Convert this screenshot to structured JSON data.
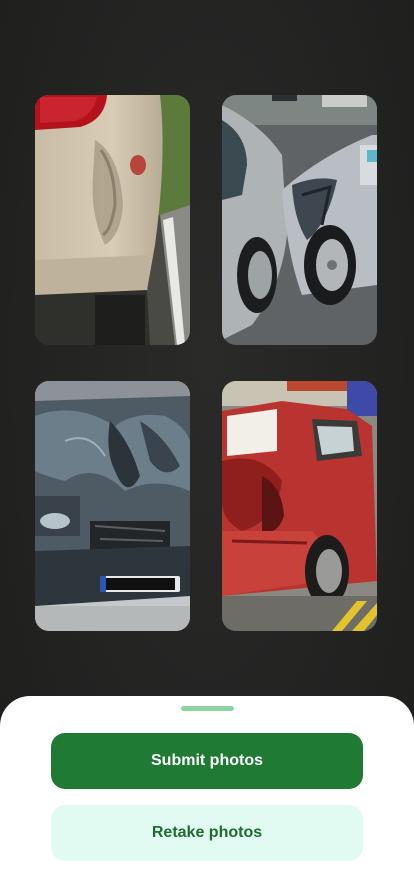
{
  "photos": [
    {
      "name": "photo-rear-dent",
      "description_icon": "car-photo"
    },
    {
      "name": "photo-side-collision",
      "description_icon": "car-photo"
    },
    {
      "name": "photo-front-crash",
      "description_icon": "car-photo"
    },
    {
      "name": "photo-red-car-damage",
      "description_icon": "car-photo"
    }
  ],
  "actions": {
    "submit_label": "Submit photos",
    "retake_label": "Retake photos"
  },
  "colors": {
    "primary": "#1f7a33",
    "secondary_bg": "#e2fbf2",
    "secondary_text": "#1f6b30",
    "handle": "#8fd3a0",
    "backdrop": "#232322"
  }
}
